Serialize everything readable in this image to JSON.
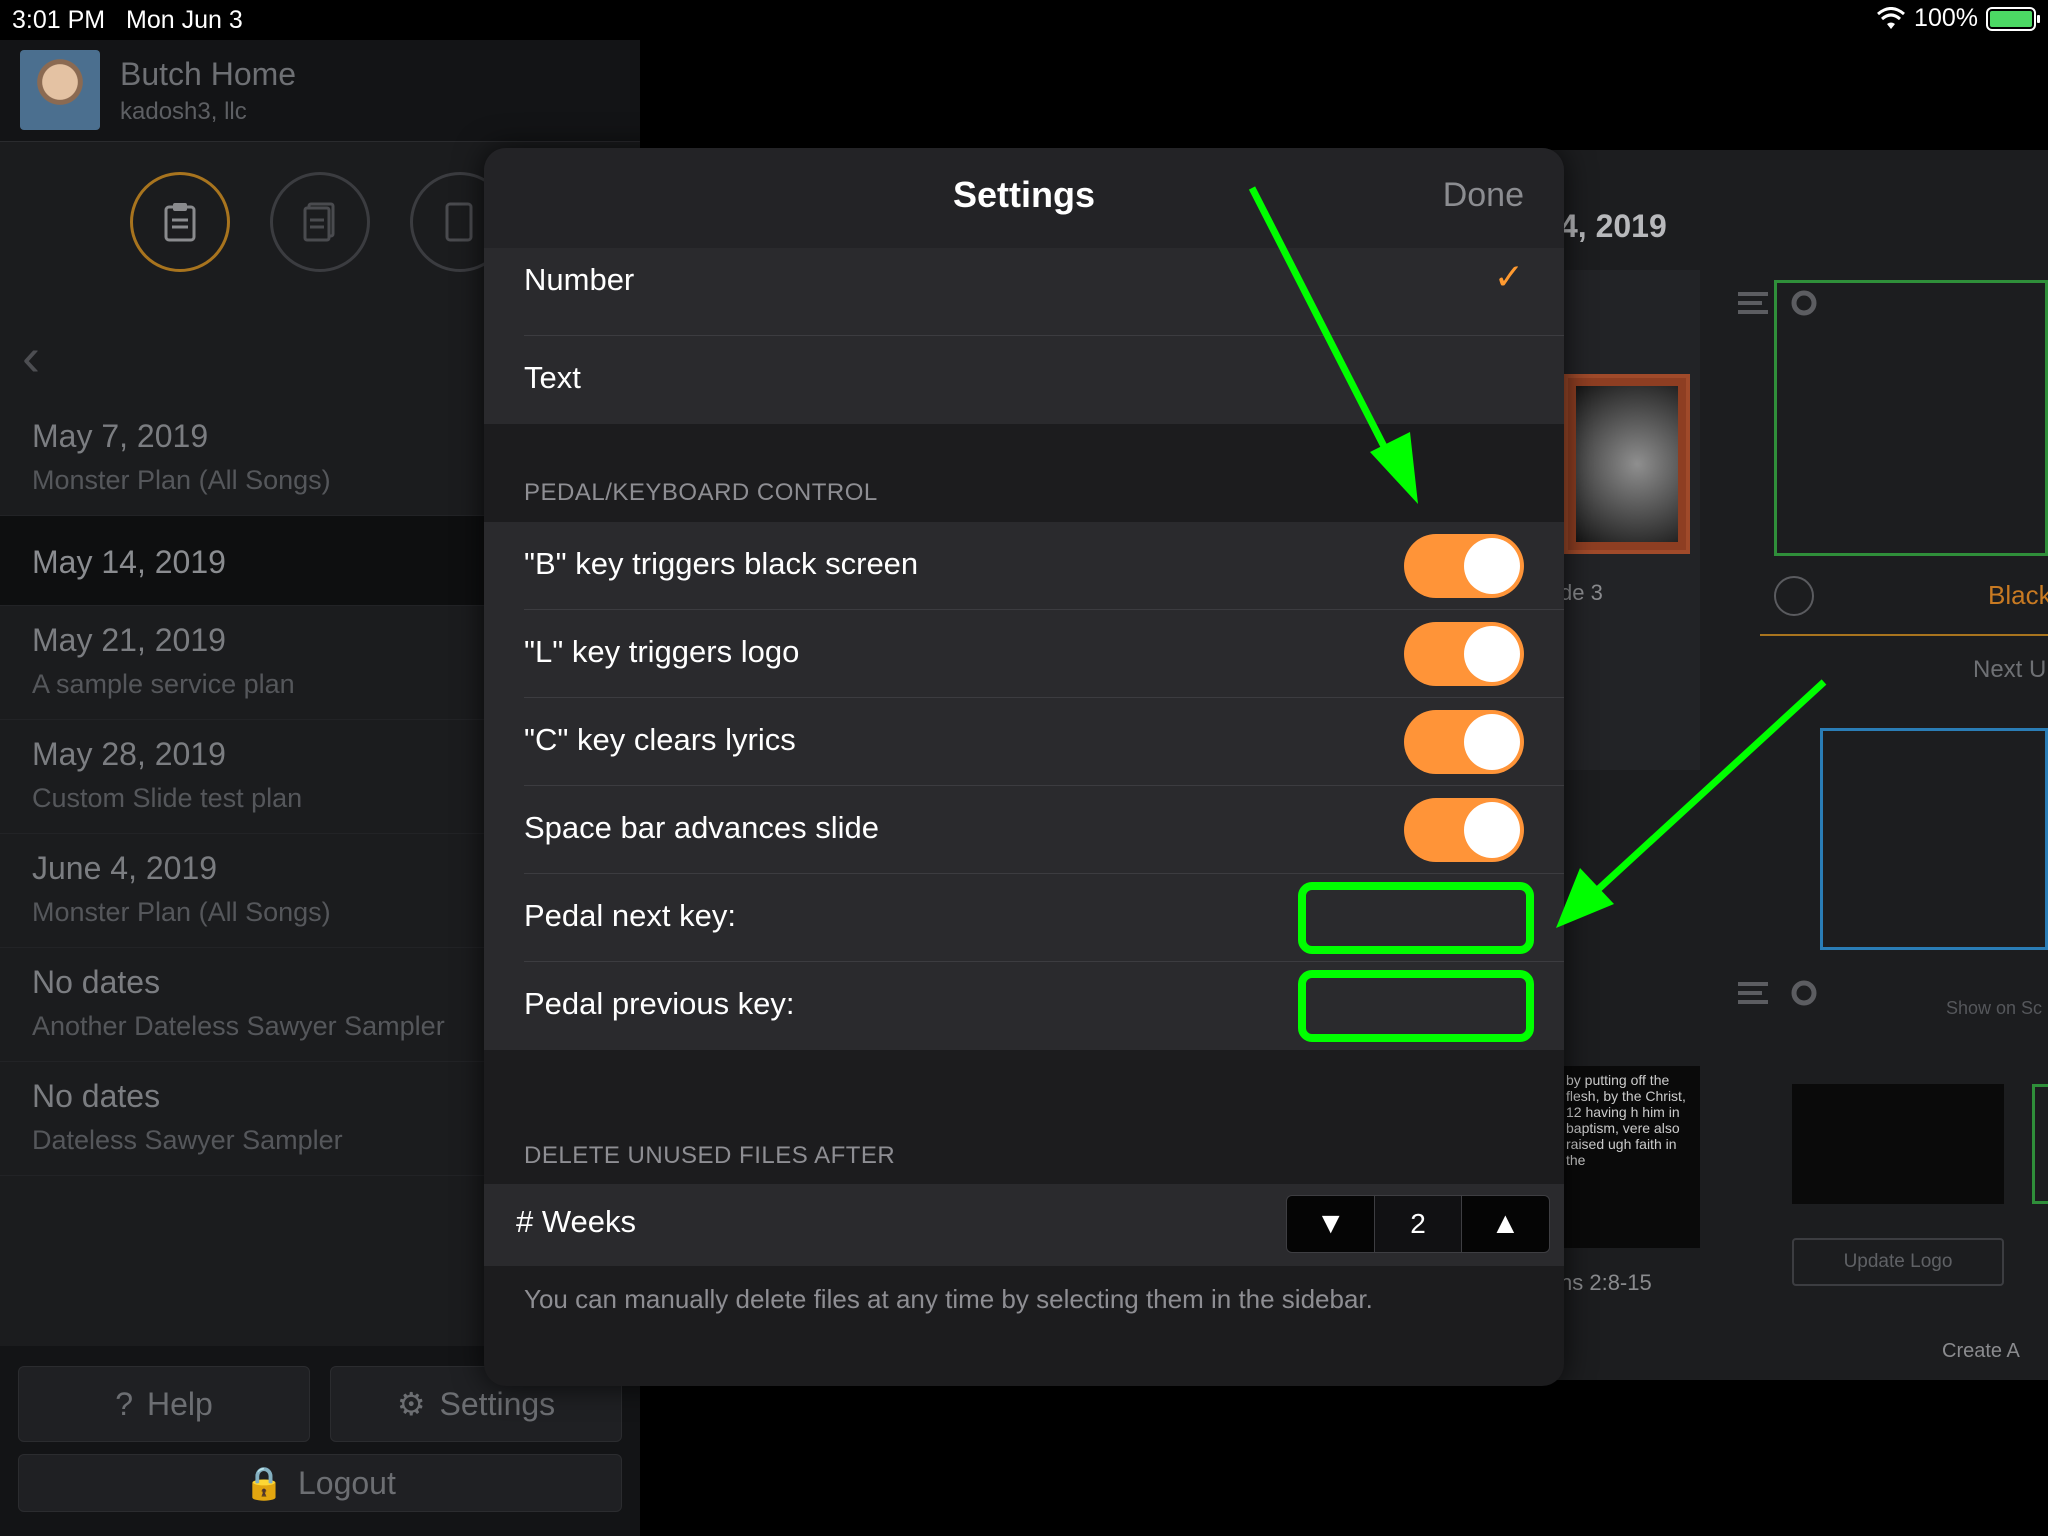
{
  "status_bar": {
    "time": "3:01 PM",
    "date": "Mon Jun 3",
    "battery": "100%"
  },
  "account": {
    "name": "Butch Home",
    "org": "kadosh3, llc"
  },
  "plans": [
    {
      "date": "May 7, 2019",
      "title": "Monster Plan (All Songs)"
    },
    {
      "date": "May 14, 2019",
      "title": ""
    },
    {
      "date": "May 21, 2019",
      "title": "A sample service plan"
    },
    {
      "date": "May 28, 2019",
      "title": "Custom Slide test plan"
    },
    {
      "date": "June 4, 2019",
      "title": "Monster Plan (All Songs)"
    },
    {
      "date": "No dates",
      "title": "Another Dateless Sawyer Sampler"
    },
    {
      "date": "No dates",
      "title": "Dateless Sawyer Sampler"
    }
  ],
  "sidebar_buttons": {
    "help": "Help",
    "settings": "Settings",
    "logout": "Logout"
  },
  "background": {
    "header_date": "4, 2019",
    "slide_label": "de 3",
    "black_label": "Black",
    "next_label": "Next U",
    "show_on": "Show on Sc",
    "lyrics": "by putting off the flesh, by the Christ, 12 having h him in baptism, vere also raised ugh faith in the",
    "ref": "ns 2:8-15",
    "update_logo": "Update Logo",
    "create": "Create A"
  },
  "settings": {
    "title": "Settings",
    "done": "Done",
    "display_options": [
      {
        "label": "Number",
        "checked": true
      },
      {
        "label": "Text",
        "checked": false
      }
    ],
    "pedal_section": "PEDAL/KEYBOARD CONTROL",
    "toggles": [
      {
        "label": "\"B\" key triggers black screen",
        "on": true
      },
      {
        "label": "\"L\" key triggers logo",
        "on": true
      },
      {
        "label": "\"C\" key clears lyrics",
        "on": true
      },
      {
        "label": "Space bar advances slide",
        "on": true
      }
    ],
    "pedal_next_label": "Pedal next key:",
    "pedal_next_value": "",
    "pedal_prev_label": "Pedal previous key:",
    "pedal_prev_value": "",
    "delete_section": "DELETE UNUSED FILES AFTER",
    "weeks_label": "# Weeks",
    "weeks_value": "2",
    "footnote": "You can manually delete files at any time by selecting them in the sidebar."
  },
  "colors": {
    "accent_orange": "#ff9438",
    "annotation_green": "#00ff00"
  }
}
